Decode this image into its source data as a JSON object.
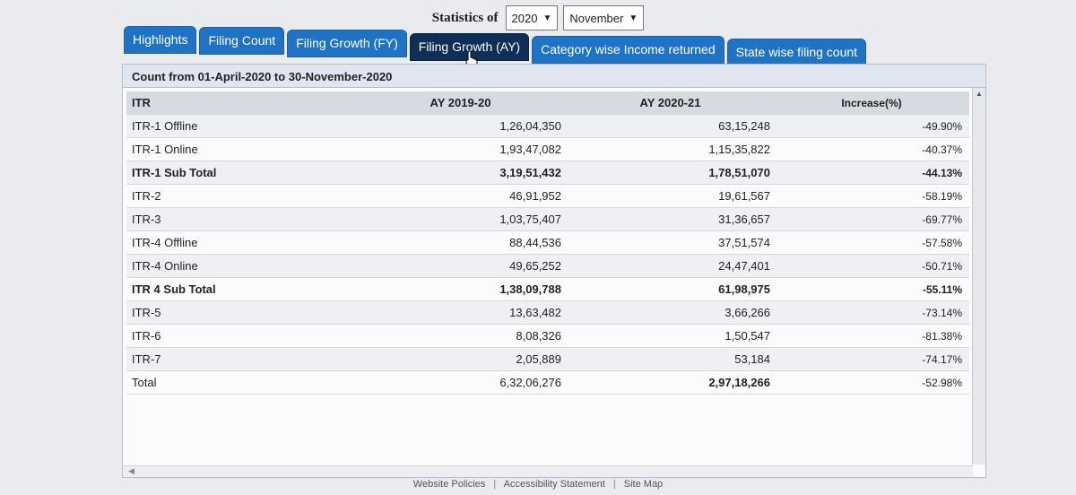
{
  "header": {
    "label": "Statistics of",
    "year": "2020",
    "month": "November"
  },
  "tabs": [
    {
      "label": "Highlights"
    },
    {
      "label": "Filing Count"
    },
    {
      "label": "Filing Growth (FY)"
    },
    {
      "label": "Filing Growth (AY)"
    },
    {
      "label": "Category wise Income returned"
    },
    {
      "label": "State wise filing count"
    }
  ],
  "panel": {
    "title": "Count from 01-April-2020 to 30-November-2020"
  },
  "table": {
    "headers": [
      "ITR",
      "AY 2019-20",
      "AY 2020-21",
      "Increase(%)"
    ],
    "rows": [
      {
        "itr": "ITR-1 Offline",
        "ay1920": "1,26,04,350",
        "ay2021": "63,15,248",
        "inc": "-49.90%"
      },
      {
        "itr": "ITR-1 Online",
        "ay1920": "1,93,47,082",
        "ay2021": "1,15,35,822",
        "inc": "-40.37%"
      },
      {
        "itr": "ITR-1 Sub Total",
        "ay1920": "3,19,51,432",
        "ay2021": "1,78,51,070",
        "inc": "-44.13%"
      },
      {
        "itr": "ITR-2",
        "ay1920": "46,91,952",
        "ay2021": "19,61,567",
        "inc": "-58.19%"
      },
      {
        "itr": "ITR-3",
        "ay1920": "1,03,75,407",
        "ay2021": "31,36,657",
        "inc": "-69.77%"
      },
      {
        "itr": "ITR-4 Offline",
        "ay1920": "88,44,536",
        "ay2021": "37,51,574",
        "inc": "-57.58%"
      },
      {
        "itr": "ITR-4 Online",
        "ay1920": "49,65,252",
        "ay2021": "24,47,401",
        "inc": "-50.71%"
      },
      {
        "itr": "ITR 4 Sub Total",
        "ay1920": "1,38,09,788",
        "ay2021": "61,98,975",
        "inc": "-55.11%"
      },
      {
        "itr": "ITR-5",
        "ay1920": "13,63,482",
        "ay2021": "3,66,266",
        "inc": "-73.14%"
      },
      {
        "itr": "ITR-6",
        "ay1920": "8,08,326",
        "ay2021": "1,50,547",
        "inc": "-81.38%"
      },
      {
        "itr": "ITR-7",
        "ay1920": "2,05,889",
        "ay2021": "53,184",
        "inc": "-74.17%"
      },
      {
        "itr": "Total",
        "ay1920": "6,32,06,276",
        "ay2021": "2,97,18,266",
        "inc": "-52.98%"
      }
    ]
  },
  "footer": {
    "links": [
      "Website Policies",
      "Accessibility Statement",
      "Site Map"
    ],
    "separator": "|"
  },
  "colors": {
    "tab": "#1f73c4",
    "tab_active": "#0f2f57"
  }
}
